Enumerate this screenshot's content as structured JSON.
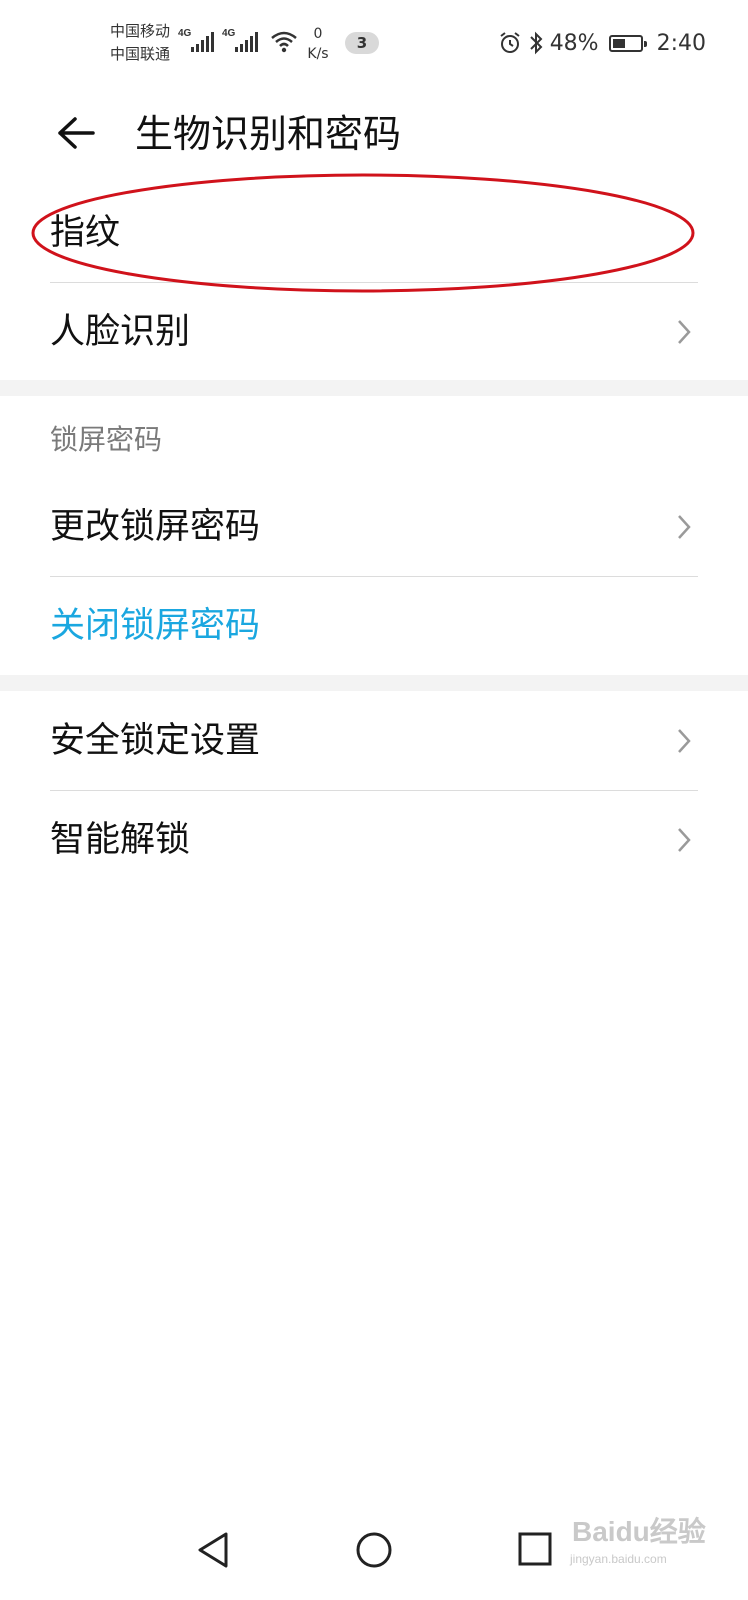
{
  "status_bar": {
    "carrier1": "中国移动",
    "carrier2": "中国联通",
    "network1": "4G",
    "network2": "4G",
    "speed_value": "0",
    "speed_unit": "K/s",
    "notification_count": "3",
    "battery": "48%",
    "battery_level": 0.48,
    "time": "2:40",
    "icons": [
      "signal-icon",
      "wifi-icon",
      "alarm-icon",
      "bluetooth-icon",
      "battery-icon"
    ]
  },
  "header": {
    "title": "生物识别和密码",
    "back_icon": "back-arrow-icon"
  },
  "biometrics": {
    "items": [
      {
        "label": "指纹"
      },
      {
        "label": "人脸识别"
      }
    ]
  },
  "lock_screen": {
    "section_title": "锁屏密码",
    "change_label": "更改锁屏密码",
    "disable_label": "关闭锁屏密码"
  },
  "other": {
    "items": [
      {
        "label": "安全锁定设置"
      },
      {
        "label": "智能解锁"
      }
    ]
  },
  "annotation": {
    "color": "#d0121b"
  },
  "colors": {
    "accent": "#1aa7e0",
    "divider": "#dcdcdc",
    "section_gap": "#f3f3f3"
  },
  "navbar": {
    "buttons": [
      "back-triangle-icon",
      "home-circle-icon",
      "recents-square-icon"
    ]
  },
  "watermark": {
    "text": "Baidu经验",
    "sub": "jingyan.baidu.com"
  }
}
